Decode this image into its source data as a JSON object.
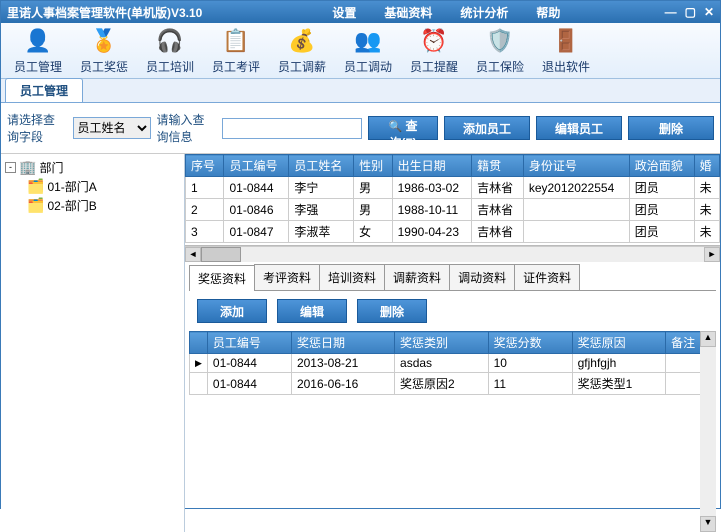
{
  "title": "里诺人事档案管理软件(单机版)V3.10",
  "menus": [
    "设置",
    "基础资料",
    "统计分析",
    "帮助"
  ],
  "toolbar": [
    {
      "icon": "👤",
      "label": "员工管理"
    },
    {
      "icon": "🏅",
      "label": "员工奖惩"
    },
    {
      "icon": "🎧",
      "label": "员工培训"
    },
    {
      "icon": "📋",
      "label": "员工考评"
    },
    {
      "icon": "💰",
      "label": "员工调薪"
    },
    {
      "icon": "👥",
      "label": "员工调动"
    },
    {
      "icon": "⏰",
      "label": "员工提醒"
    },
    {
      "icon": "🛡️",
      "label": "员工保险"
    },
    {
      "icon": "🚪",
      "label": "退出软件"
    }
  ],
  "activeTab": "员工管理",
  "search": {
    "fieldLabel": "请选择查询字段",
    "fieldValue": "员工姓名",
    "inputLabel": "请输入查询信息",
    "queryBtn": "查询(F)",
    "addBtn": "添加员工",
    "editBtn": "编辑员工",
    "delBtn": "删除"
  },
  "tree": {
    "root": "部门",
    "children": [
      "01-部门A",
      "02-部门B"
    ]
  },
  "empCols": [
    "序号",
    "员工编号",
    "员工姓名",
    "性别",
    "出生日期",
    "籍贯",
    "身份证号",
    "政治面貌",
    "婚"
  ],
  "empRows": [
    [
      "1",
      "01-0844",
      "李宁",
      "男",
      "1986-03-02",
      "吉林省",
      "key2012022554",
      "团员",
      "未"
    ],
    [
      "2",
      "01-0846",
      "李强",
      "男",
      "1988-10-11",
      "吉林省",
      "",
      "团员",
      "未"
    ],
    [
      "3",
      "01-0847",
      "李淑萃",
      "女",
      "1990-04-23",
      "吉林省",
      "",
      "团员",
      "未"
    ]
  ],
  "subtabs": [
    "奖惩资料",
    "考评资料",
    "培训资料",
    "调薪资料",
    "调动资料",
    "证件资料"
  ],
  "subBtns": {
    "add": "添加",
    "edit": "编辑",
    "del": "删除"
  },
  "detCols": [
    "员工编号",
    "奖惩日期",
    "奖惩类别",
    "奖惩分数",
    "奖惩原因",
    "备注"
  ],
  "detRows": [
    [
      "01-0844",
      "2013-08-21",
      "asdas",
      "10",
      "gfjhfgjh",
      ""
    ],
    [
      "01-0844",
      "2016-06-16",
      "奖惩原因2",
      "11",
      "奖惩类型1",
      ""
    ]
  ]
}
